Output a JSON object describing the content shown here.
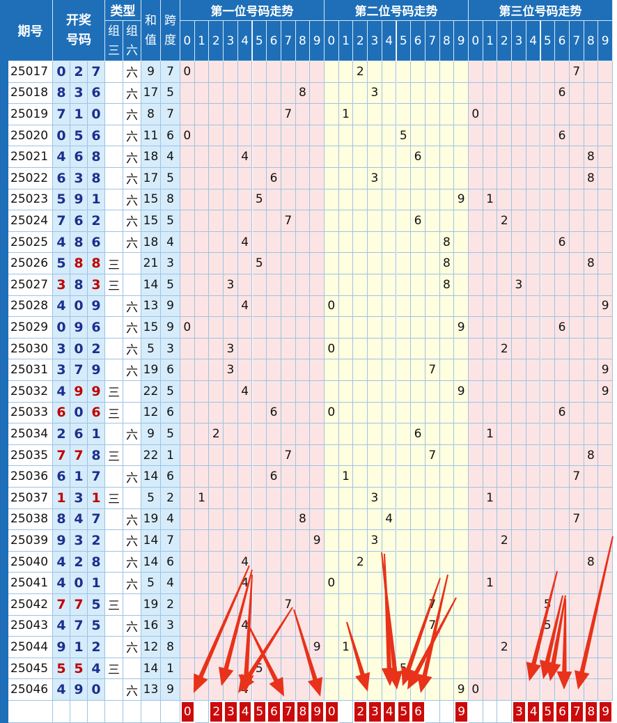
{
  "headers": {
    "period": "期号",
    "draw": "开奖号码",
    "type": "类型",
    "type_g3": "组三",
    "type_g6": "组六",
    "sum": "和值",
    "span": "跨度",
    "pos1": "第一位号码走势",
    "pos2": "第二位号码走势",
    "pos3": "第三位号码走势",
    "digits": [
      "0",
      "1",
      "2",
      "3",
      "4",
      "5",
      "6",
      "7",
      "8",
      "9"
    ]
  },
  "g3_label": "三",
  "g6_label": "六",
  "rows": [
    {
      "period": "25017",
      "nums": [
        0,
        2,
        7
      ],
      "type": "六",
      "sum": 9,
      "span": 7
    },
    {
      "period": "25018",
      "nums": [
        8,
        3,
        6
      ],
      "type": "六",
      "sum": 17,
      "span": 5
    },
    {
      "period": "25019",
      "nums": [
        7,
        1,
        0
      ],
      "type": "六",
      "sum": 8,
      "span": 7
    },
    {
      "period": "25020",
      "nums": [
        0,
        5,
        6
      ],
      "type": "六",
      "sum": 11,
      "span": 6
    },
    {
      "period": "25021",
      "nums": [
        4,
        6,
        8
      ],
      "type": "六",
      "sum": 18,
      "span": 4
    },
    {
      "period": "25022",
      "nums": [
        6,
        3,
        8
      ],
      "type": "六",
      "sum": 17,
      "span": 5
    },
    {
      "period": "25023",
      "nums": [
        5,
        9,
        1
      ],
      "type": "六",
      "sum": 15,
      "span": 8
    },
    {
      "period": "25024",
      "nums": [
        7,
        6,
        2
      ],
      "type": "六",
      "sum": 15,
      "span": 5
    },
    {
      "period": "25025",
      "nums": [
        4,
        8,
        6
      ],
      "type": "六",
      "sum": 18,
      "span": 4
    },
    {
      "period": "25026",
      "nums": [
        5,
        8,
        8
      ],
      "type": "三",
      "sum": 21,
      "span": 3
    },
    {
      "period": "25027",
      "nums": [
        3,
        8,
        3
      ],
      "type": "三",
      "sum": 14,
      "span": 5
    },
    {
      "period": "25028",
      "nums": [
        4,
        0,
        9
      ],
      "type": "六",
      "sum": 13,
      "span": 9
    },
    {
      "period": "25029",
      "nums": [
        0,
        9,
        6
      ],
      "type": "六",
      "sum": 15,
      "span": 9
    },
    {
      "period": "25030",
      "nums": [
        3,
        0,
        2
      ],
      "type": "六",
      "sum": 5,
      "span": 3
    },
    {
      "period": "25031",
      "nums": [
        3,
        7,
        9
      ],
      "type": "六",
      "sum": 19,
      "span": 6
    },
    {
      "period": "25032",
      "nums": [
        4,
        9,
        9
      ],
      "type": "三",
      "sum": 22,
      "span": 5
    },
    {
      "period": "25033",
      "nums": [
        6,
        0,
        6
      ],
      "type": "三",
      "sum": 12,
      "span": 6
    },
    {
      "period": "25034",
      "nums": [
        2,
        6,
        1
      ],
      "type": "六",
      "sum": 9,
      "span": 5
    },
    {
      "period": "25035",
      "nums": [
        7,
        7,
        8
      ],
      "type": "三",
      "sum": 22,
      "span": 1
    },
    {
      "period": "25036",
      "nums": [
        6,
        1,
        7
      ],
      "type": "六",
      "sum": 14,
      "span": 6
    },
    {
      "period": "25037",
      "nums": [
        1,
        3,
        1
      ],
      "type": "三",
      "sum": 5,
      "span": 2
    },
    {
      "period": "25038",
      "nums": [
        8,
        4,
        7
      ],
      "type": "六",
      "sum": 19,
      "span": 4
    },
    {
      "period": "25039",
      "nums": [
        9,
        3,
        2
      ],
      "type": "六",
      "sum": 14,
      "span": 7
    },
    {
      "period": "25040",
      "nums": [
        4,
        2,
        8
      ],
      "type": "六",
      "sum": 14,
      "span": 6
    },
    {
      "period": "25041",
      "nums": [
        4,
        0,
        1
      ],
      "type": "六",
      "sum": 5,
      "span": 4
    },
    {
      "period": "25042",
      "nums": [
        7,
        7,
        5
      ],
      "type": "三",
      "sum": 19,
      "span": 2
    },
    {
      "period": "25043",
      "nums": [
        4,
        7,
        5
      ],
      "type": "六",
      "sum": 16,
      "span": 3
    },
    {
      "period": "25044",
      "nums": [
        9,
        1,
        2
      ],
      "type": "六",
      "sum": 12,
      "span": 8
    },
    {
      "period": "25045",
      "nums": [
        5,
        5,
        4
      ],
      "type": "三",
      "sum": 14,
      "span": 1
    },
    {
      "period": "25046",
      "nums": [
        4,
        9,
        0
      ],
      "type": "六",
      "sum": 13,
      "span": 9
    }
  ],
  "selection": {
    "pos1": [
      0,
      2,
      3,
      4,
      5,
      6,
      7,
      8,
      9
    ],
    "pos2": [
      0,
      2,
      3,
      4,
      5,
      6,
      9
    ],
    "pos3": [
      3,
      4,
      5,
      6,
      7,
      8,
      9
    ]
  },
  "colors": {
    "header_bg": "#1e6fb8",
    "number_blue": "#1c2f8c",
    "number_red": "#c00000",
    "pos1_bg": "#fde4e4",
    "pos2_bg": "#ffffe0",
    "pos3_bg": "#fde4e4",
    "mark_bg": "#cc0a0a",
    "arrow": "#e8321a"
  }
}
